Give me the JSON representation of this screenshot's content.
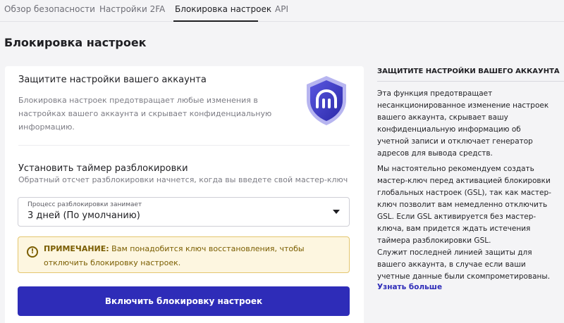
{
  "tabs": [
    {
      "label": "Обзор безопасности",
      "active": false
    },
    {
      "label": "Настройки 2FA",
      "active": false
    },
    {
      "label": "Блокировка настроек",
      "active": true
    },
    {
      "label": "API",
      "active": false
    }
  ],
  "page_title": "Блокировка настроек",
  "card": {
    "protect_title": "Защитите настройки вашего аккаунта",
    "protect_desc": "Блокировка настроек предотвращает любые изменения в настройках вашего аккаунта и скрывает конфиденциальную информацию.",
    "shield_icon": "shield-logo-icon",
    "timer_title": "Установить таймер разблокировки",
    "timer_desc": "Обратный отсчет разблокировки начнется, когда вы введете свой мастер-ключ",
    "select_label": "Процесс разблокировки занимает",
    "select_value": "3 дней (По умолчанию)",
    "note_prefix": "ПРИМЕЧАНИЕ:",
    "note_text": " Вам понадобится ключ восстановления, чтобы отключить блокировку настроек.",
    "enable_button": "Включить блокировку настроек"
  },
  "aside": {
    "title": "ЗАЩИТИТЕ НАСТРОЙКИ ВАШЕГО АККАУНТА",
    "p1": "Эта функция предотвращает несанкционированное изменение настроек вашего аккаунта, скрывает вашу конфиденциальную информацию об учетной записи и отключает генератор адресов для вывода средств.",
    "p2": "Мы настоятельно рекомендуем создать мастер-ключ перед активацией блокировки глобальных настроек (GSL), так как мастер-ключ позволит вам немедленно отключить GSL. Если GSL активируется без мастер-ключа, вам придется ждать истечения таймера разблокировки GSL.",
    "p3": "Служит последней линией защиты для вашего аккаунта, в случае если ваши учетные данные были скомпрометированы.",
    "learn_more": "Узнать больше"
  },
  "colors": {
    "accent": "#2e2cb8",
    "note_bg": "#fdf6e0",
    "note_border": "#e4c66f",
    "note_text": "#7a5d00"
  }
}
